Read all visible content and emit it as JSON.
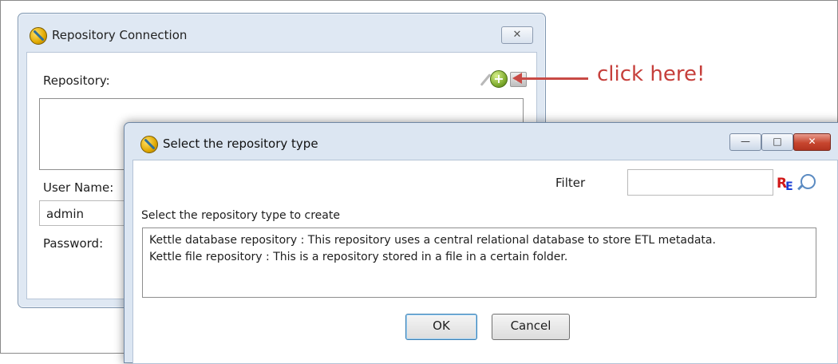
{
  "repo_connection": {
    "title": "Repository Connection",
    "close_glyph": "✕",
    "repository_label": "Repository:",
    "add_glyph": "+",
    "delete_glyph": "✕",
    "user_name_label": "User Name:",
    "user_name_value": "admin",
    "password_label": "Password:"
  },
  "annotation": {
    "text": "click here!",
    "color": "#c63f3b"
  },
  "select_dialog": {
    "title": "Select the repository type",
    "minimize_glyph": "—",
    "maximize_glyph": "□",
    "close_glyph": "✕",
    "filter_label": "Filter",
    "filter_value": "",
    "regex_r": "R",
    "regex_e": "E",
    "select_label": "Select the repository type to create",
    "repository_types": [
      "Kettle database repository : This repository uses a central relational database to store ETL metadata.",
      "Kettle file repository : This is a repository stored in a file in a certain folder."
    ],
    "ok_label": "OK",
    "cancel_label": "Cancel"
  }
}
